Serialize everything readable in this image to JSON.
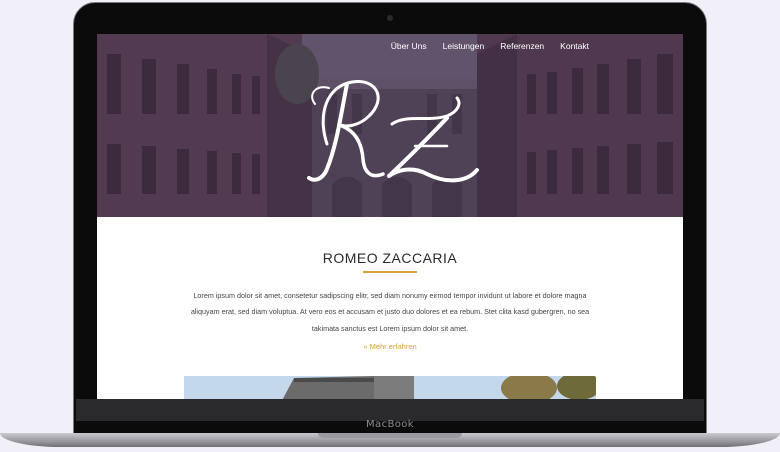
{
  "device": {
    "brand_label": "MacBook"
  },
  "nav": {
    "items": [
      {
        "label": "Über Uns"
      },
      {
        "label": "Leistungen"
      },
      {
        "label": "Referenzen"
      },
      {
        "label": "Kontakt"
      }
    ]
  },
  "hero": {
    "monogram_text": "RZ"
  },
  "content": {
    "title": "ROMEO ZACCARIA",
    "paragraph": "Lorem ipsum dolor sit amet, consetetur sadipscing elitr, sed diam nonumy eirmod tempor invidunt ut labore et dolore magna aliquyam erat, sed diam voluptua. At vero eos et accusam et justo duo dolores et ea rebum. Stet clita kasd gubergren, no sea takimata sanctus est Lorem ipsum dolor sit amet.",
    "more_link": "» Mehr erfahren"
  },
  "colors": {
    "accent": "#d6a23a",
    "hero_overlay": "#4a3850",
    "text": "#2b2b2b"
  }
}
